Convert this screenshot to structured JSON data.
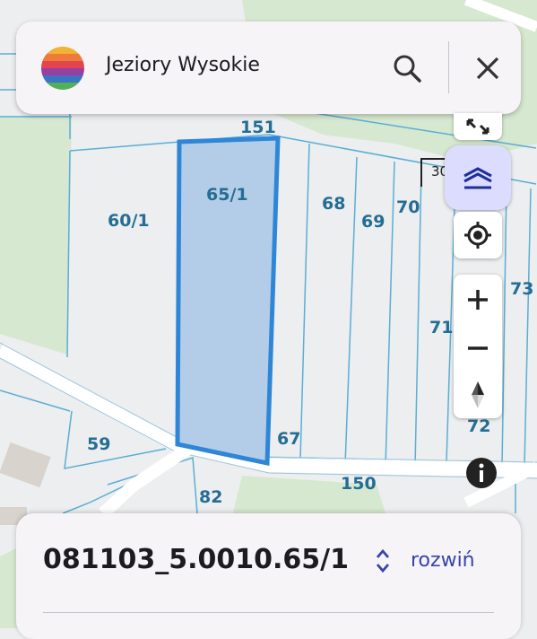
{
  "search": {
    "query": "Jeziory Wysokie"
  },
  "map": {
    "parcels": [
      {
        "id": "151",
        "label": "151"
      },
      {
        "id": "65-1",
        "label": "65/1",
        "selected": true
      },
      {
        "id": "60-1",
        "label": "60/1"
      },
      {
        "id": "68",
        "label": "68"
      },
      {
        "id": "69",
        "label": "69"
      },
      {
        "id": "70",
        "label": "70"
      },
      {
        "id": "73",
        "label": "73"
      },
      {
        "id": "71",
        "label": "71"
      },
      {
        "id": "72",
        "label": "72"
      },
      {
        "id": "59",
        "label": "59"
      },
      {
        "id": "67",
        "label": "67"
      },
      {
        "id": "150",
        "label": "150"
      },
      {
        "id": "82",
        "label": "82"
      }
    ],
    "scale_label": "30",
    "colors": {
      "parcel_border": "#5aaed6",
      "selected_fill": "#b3cde8",
      "selected_border": "#2f86d6",
      "green_area": "#d6e8cf",
      "road": "#ffffff"
    }
  },
  "controls": {
    "icons": [
      "fullscreen-icon",
      "layers-icon",
      "my-location-icon",
      "zoom-in-icon",
      "zoom-out-icon",
      "compass-icon",
      "info-icon"
    ]
  },
  "bottom_sheet": {
    "parcel_id": "081103_5.0010.65/1",
    "expand_label": "rozwiń"
  }
}
